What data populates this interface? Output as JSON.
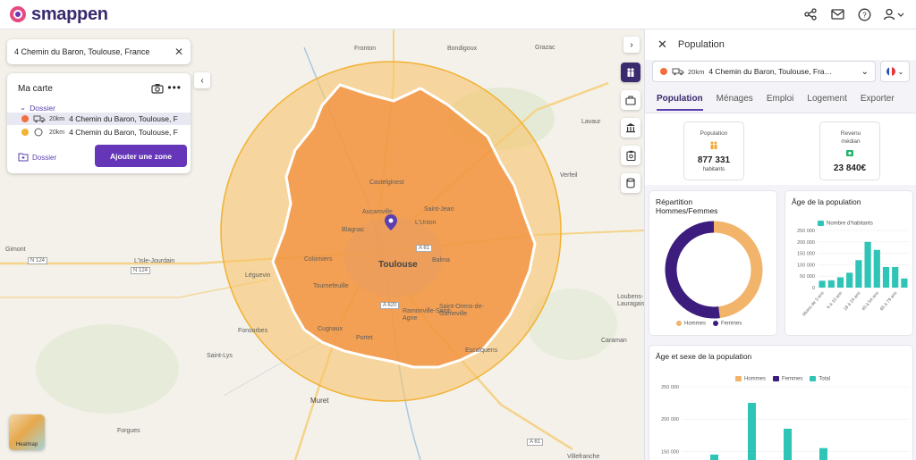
{
  "app": {
    "name": "smappen",
    "byline": "by"
  },
  "top_actions": [
    "share-icon",
    "mail-icon",
    "help-icon",
    "user-icon"
  ],
  "search": {
    "value": "4 Chemin du Baron, Toulouse, France"
  },
  "my_map": {
    "title": "Ma carte",
    "folder_label": "Dossier",
    "zones": [
      {
        "color": "#f26f3e",
        "radius": "20km",
        "name": "4 Chemin du Baron, Toulouse, France",
        "active": true
      },
      {
        "color": "#f2b233",
        "radius": "20km",
        "name": "4 Chemin du Baron, Toulouse, France",
        "active": false
      }
    ],
    "add_folder_label": "Dossier",
    "add_zone_label": "Ajouter une zone"
  },
  "heatmap_label": "Heatmap",
  "map_labels": [
    "Fronton",
    "Bondigoux",
    "Grazac",
    "Castelginest",
    "Saint-Jean",
    "L'Union",
    "Aucamville",
    "Blagnac",
    "Toulouse",
    "Balma",
    "Colomiers",
    "Tournefeuille",
    "Ramonville-Saint-Agne",
    "Saint-Orens-de-Gameville",
    "Muret",
    "Fonsorbes",
    "Saint-Lys",
    "Forgues",
    "Gimont",
    "L'Isle-Jourdain",
    "Léguevin",
    "Cugnaux",
    "Escalquens",
    "Portet",
    "Caraman",
    "Villefranche",
    "Verfeil",
    "Lavaur",
    "Loubens-Lauragais"
  ],
  "map_roads": [
    "N 124",
    "N 124",
    "A 62",
    "A 61",
    "A 64",
    "A 680",
    "A 620",
    "A 61"
  ],
  "panel": {
    "title": "Population",
    "zone_select": {
      "radius": "20km",
      "name": "4 Chemin du Baron, Toulouse, France"
    },
    "tabs": [
      "Population",
      "Ménages",
      "Emploi",
      "Logement",
      "Exporter"
    ],
    "active_tab": "Population",
    "kpis": [
      {
        "label": "Population",
        "value": "877 331",
        "sub": "habitants"
      },
      {
        "label": "Revenu médian",
        "value": "23 840€",
        "sub": ""
      }
    ],
    "gender_card": {
      "title": "Répartition Hommes/Femmes",
      "legend": [
        "Hommes",
        "Femmes"
      ]
    },
    "age_card": {
      "title": "Âge de la population",
      "legend": "Nombre d'habitants",
      "y_ticks": [
        "250 000",
        "200 000",
        "150 000",
        "100 000",
        "50 000",
        "0"
      ],
      "x_ticks": [
        "Moins de 3 ans",
        "6 à 10 ans",
        "18 à 24 ans",
        "40 à 54 ans",
        "65 à 79 ans"
      ]
    },
    "age_sex_card": {
      "title": "Âge et sexe de la population",
      "legend": [
        "Hommes",
        "Femmes",
        "Total"
      ],
      "y_ticks": [
        "250 000",
        "200 000",
        "150 000"
      ]
    }
  },
  "colors": {
    "brand": "#3a2a6e",
    "accent": "#6537b8",
    "hommes": "#f1b46a",
    "femmes": "#3c1c7c",
    "total": "#2ec4b6",
    "zone_fill": "#f4a545"
  },
  "chart_data": [
    {
      "type": "pie",
      "title": "Répartition Hommes/Femmes",
      "categories": [
        "Hommes",
        "Femmes"
      ],
      "values": [
        48,
        52
      ]
    },
    {
      "type": "bar",
      "title": "Âge de la population",
      "series": [
        {
          "name": "Nombre d'habitants",
          "values": [
            30000,
            32000,
            45000,
            65000,
            120000,
            200000,
            165000,
            90000,
            90000,
            40000
          ]
        }
      ],
      "ylim": [
        0,
        250000
      ]
    },
    {
      "type": "bar",
      "title": "Âge et sexe de la population",
      "series": [
        {
          "name": "Total",
          "values": [
            145000,
            225000,
            185000,
            155000
          ]
        }
      ],
      "ylim": [
        120000,
        250000
      ]
    }
  ]
}
